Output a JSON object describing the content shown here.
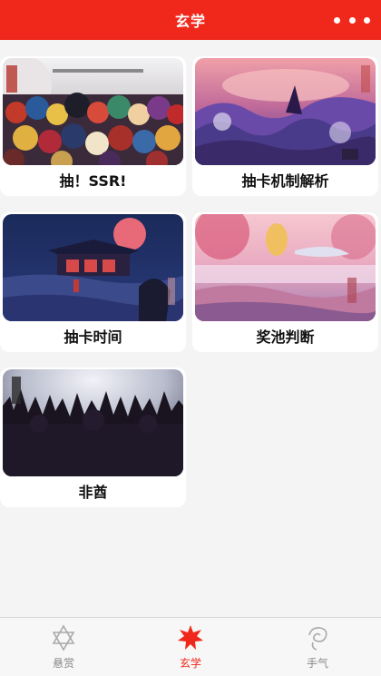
{
  "header": {
    "title": "玄学",
    "more_icon": "more-dots-icon"
  },
  "cards": [
    {
      "label": "抽！SSR!",
      "image": "shikigami-crowd-illustration"
    },
    {
      "label": "抽卡机制解析",
      "image": "purple-sea-waves-illustration"
    },
    {
      "label": "抽卡时间",
      "image": "night-shrine-red-moon-illustration"
    },
    {
      "label": "奖池判断",
      "image": "pink-cherry-blossom-illustration"
    },
    {
      "label": "非酋",
      "image": "dark-crowd-silhouette-illustration"
    }
  ],
  "tabs": [
    {
      "label": "悬赏",
      "icon": "hexagram-icon",
      "active": false
    },
    {
      "label": "玄学",
      "icon": "star-burst-icon",
      "active": true
    },
    {
      "label": "手气",
      "icon": "swirl-icon",
      "active": false
    }
  ],
  "colors": {
    "accent": "#f0281c",
    "inactive": "#888888"
  }
}
